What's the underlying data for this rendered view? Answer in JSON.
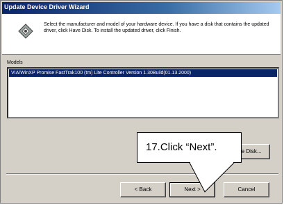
{
  "window": {
    "title": "Update Device Driver Wizard",
    "description": "Select the manufacturer and model of your hardware device. If you have a disk that contains the updated driver, click Have Disk. To install the updated driver, click Finish."
  },
  "models": {
    "label": "Models",
    "items": [
      "VIA/WinXP Promise FastTrak100 (tm) Lite Controller Version 1.30Build(01.13.2000)"
    ]
  },
  "buttons": {
    "have_disk": "Have Disk...",
    "back": "< Back",
    "next": "Next >",
    "cancel": "Cancel"
  },
  "callout": {
    "text": "17.Click “Next”."
  },
  "icons": {
    "wizard": "wizard-hardware-icon"
  },
  "colors": {
    "title_bar": "#0a246a",
    "selection": "#0a246a",
    "dialog_bg": "#d4d0c8"
  }
}
